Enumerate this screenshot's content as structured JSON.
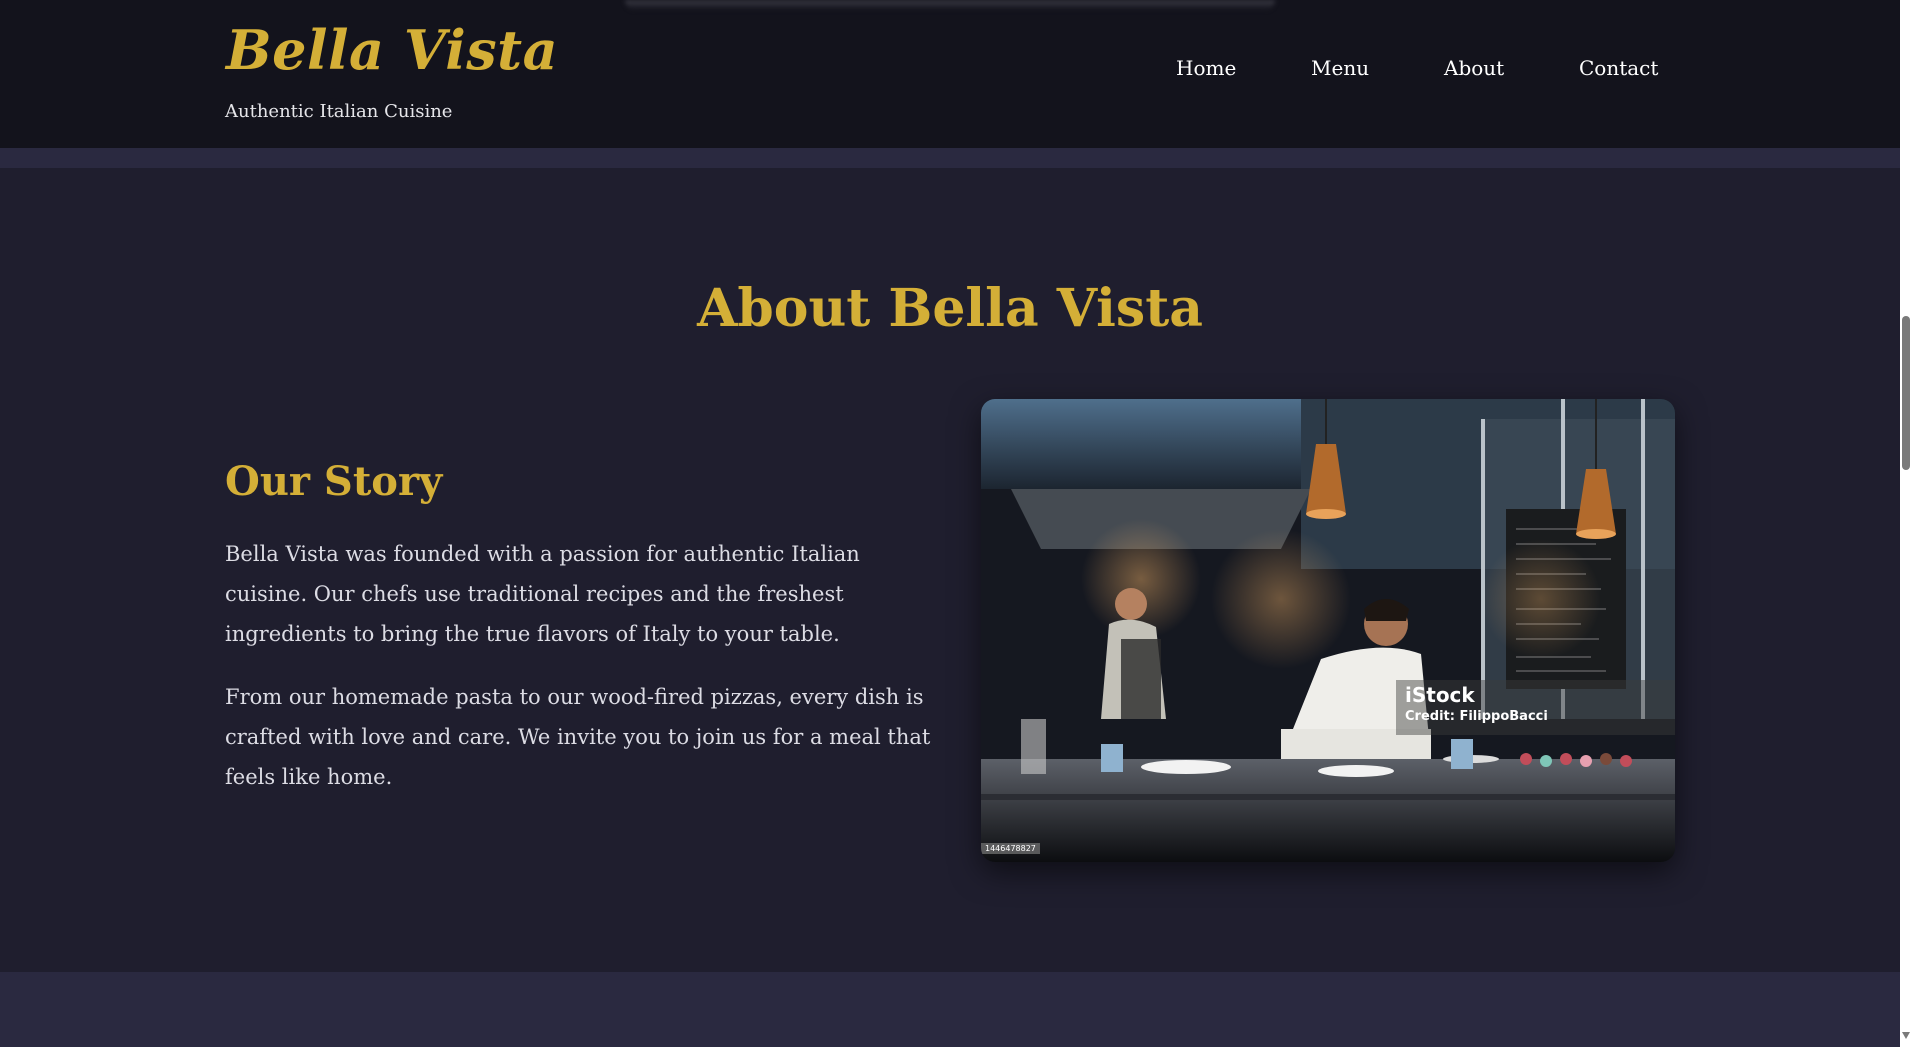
{
  "header": {
    "brand_title": "Bella Vista",
    "tagline": "Authentic Italian Cuisine",
    "nav": [
      {
        "label": "Home"
      },
      {
        "label": "Menu"
      },
      {
        "label": "About"
      },
      {
        "label": "Contact"
      }
    ]
  },
  "about": {
    "heading": "About Bella Vista",
    "story_heading": "Our Story",
    "paragraphs": [
      "Bella Vista was founded with a passion for authentic Italian cuisine. Our chefs use traditional recipes and the freshest ingredients to bring the true flavors of Italy to your table.",
      "From our homemade pasta to our wood-fired pizzas, every dish is crafted with love and care. We invite you to join us for a meal that feels like home."
    ],
    "image": {
      "watermark_brand": "iStock",
      "watermark_credit": "Credit: FilippoBacci",
      "watermark_id": "1446478827"
    }
  },
  "colors": {
    "accent_gold": "#d4af37",
    "header_bg": "#13131c",
    "section_bg": "#1f1e2e",
    "band_bg": "#2a2940"
  }
}
